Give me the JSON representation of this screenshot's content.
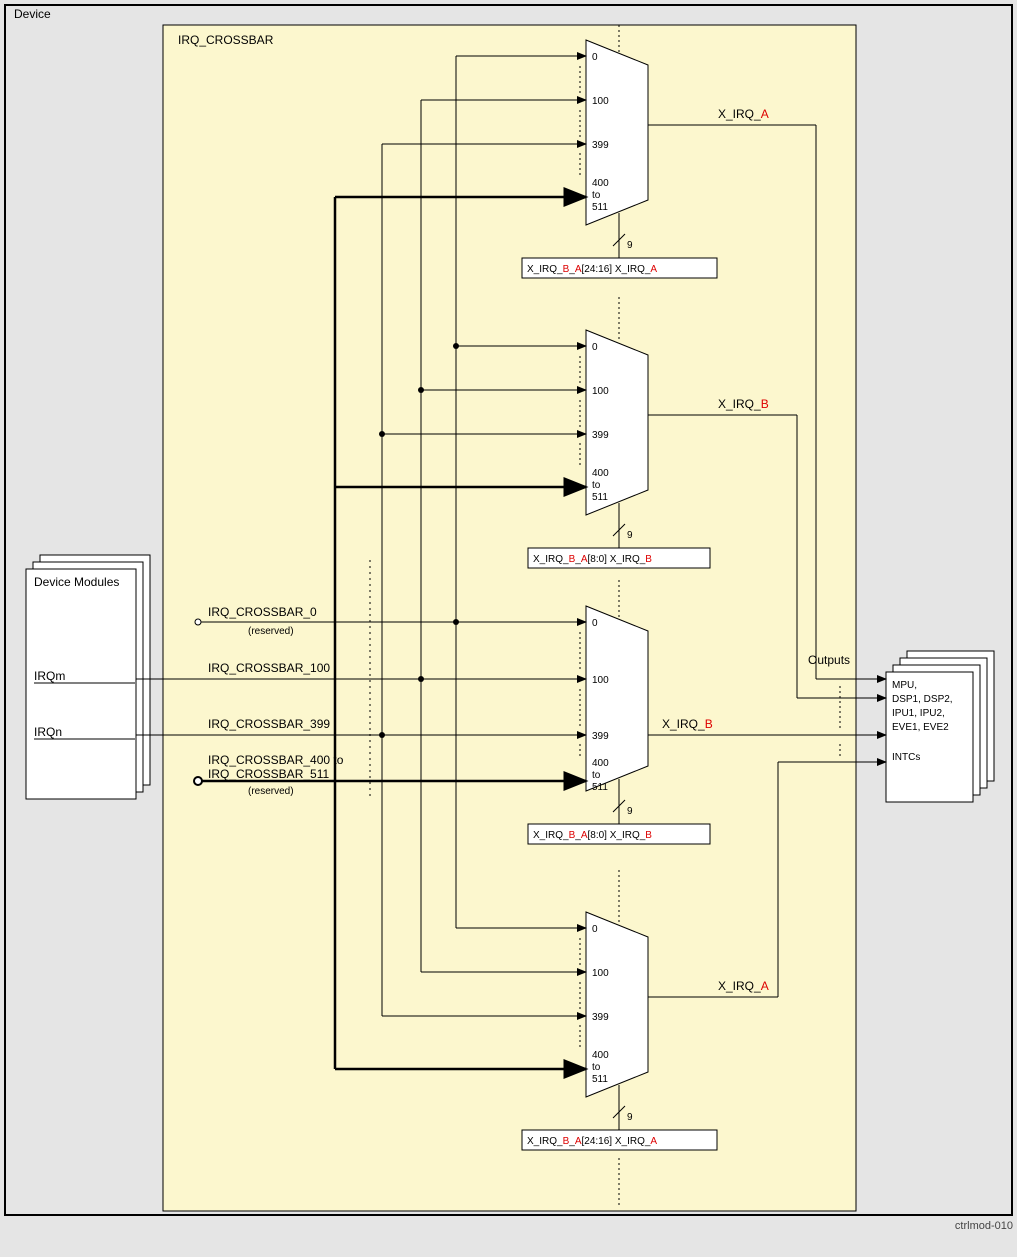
{
  "device_label": "Device",
  "crossbar_label": "IRQ_CROSSBAR",
  "left_box_label": "Device Modules",
  "left_signals": [
    "IRQm",
    "IRQn"
  ],
  "bus_labels": {
    "cb0": "IRQ_CROSSBAR_0",
    "cb0_note": "(reserved)",
    "cb100": "IRQ_CROSSBAR_100",
    "cb399": "IRQ_CROSSBAR_399",
    "cb400_511a": "IRQ_CROSSBAR_400 to",
    "cb400_511b": "IRQ_CROSSBAR_511",
    "cb400_note": "(reserved)"
  },
  "mux_inputs": [
    "0",
    "100",
    "399",
    "400\nto\n511"
  ],
  "mux_sel_width": "9",
  "reg_high_prefix": "X_IRQ_",
  "reg_high_B": "B",
  "reg_high_us": "_",
  "reg_high_A": "A",
  "reg_high_bits": "[24:16] X_IRQ_",
  "reg_high_tail": "A",
  "reg_low_prefix": "X_IRQ_",
  "reg_low_B": "B",
  "reg_low_us": "_",
  "reg_low_A": "A",
  "reg_low_bits": "[8:0] X_IRQ_",
  "reg_low_tail": "B",
  "out_irq_prefix": "X_IRQ_",
  "out_A": "A",
  "out_B": "B",
  "outputs_label": "Outputs",
  "right_box_lines": [
    "MPU,",
    "DSP1, DSP2,",
    "IPU1, IPU2,",
    "EVE1, EVE2",
    "",
    "INTCs"
  ],
  "footer": "ctrlmod-010"
}
